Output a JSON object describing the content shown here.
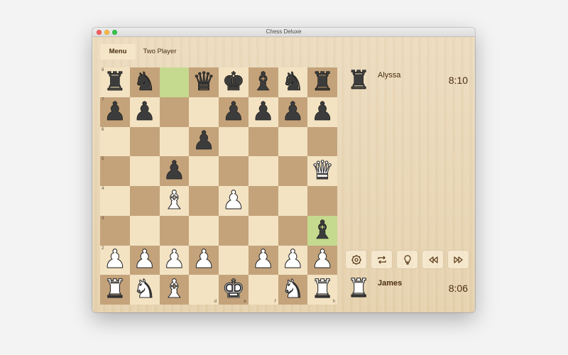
{
  "window": {
    "title": "Chess Deluxe"
  },
  "toolbar": {
    "menu_label": "Menu",
    "mode_label": "Two Player"
  },
  "board": {
    "rows": [
      [
        [
          "r",
          "b"
        ],
        [
          "n",
          "b"
        ],
        null,
        [
          "q",
          "b"
        ],
        [
          "k",
          "b"
        ],
        [
          "b",
          "b"
        ],
        [
          "n",
          "b"
        ],
        [
          "r",
          "b"
        ]
      ],
      [
        [
          "p",
          "b"
        ],
        [
          "p",
          "b"
        ],
        null,
        null,
        [
          "p",
          "b"
        ],
        [
          "p",
          "b"
        ],
        [
          "p",
          "b"
        ],
        [
          "p",
          "b"
        ]
      ],
      [
        null,
        null,
        null,
        [
          "p",
          "b"
        ],
        null,
        null,
        null,
        null
      ],
      [
        null,
        null,
        [
          "p",
          "b"
        ],
        null,
        null,
        null,
        null,
        [
          "q",
          "w"
        ]
      ],
      [
        null,
        null,
        [
          "b",
          "w"
        ],
        null,
        [
          "p",
          "w"
        ],
        null,
        null,
        null
      ],
      [
        null,
        null,
        null,
        null,
        null,
        null,
        null,
        [
          "b",
          "b"
        ]
      ],
      [
        [
          "p",
          "w"
        ],
        [
          "p",
          "w"
        ],
        [
          "p",
          "w"
        ],
        [
          "p",
          "w"
        ],
        null,
        [
          "p",
          "w"
        ],
        [
          "p",
          "w"
        ],
        [
          "p",
          "w"
        ]
      ],
      [
        [
          "r",
          "w"
        ],
        [
          "n",
          "w"
        ],
        [
          "b",
          "w"
        ],
        null,
        [
          "k",
          "w"
        ],
        null,
        [
          "n",
          "w"
        ],
        [
          "r",
          "w"
        ]
      ]
    ],
    "highlighted": [
      "c8",
      "h3"
    ],
    "rank_labels": [
      "8",
      "7",
      "6",
      "5",
      "4",
      "3",
      "2"
    ],
    "file_labels": [
      "d",
      "e",
      "f",
      "h"
    ],
    "colors": {
      "light": "#f3e3c3",
      "dark": "#c4a37b",
      "highlight": "#c5d98f"
    }
  },
  "players": {
    "top": {
      "name": "Alyssa",
      "clock": "8:10",
      "piece": "rook-black-icon"
    },
    "bottom": {
      "name": "James",
      "clock": "8:06",
      "piece": "rook-white-icon"
    }
  },
  "controls": [
    {
      "name": "settings-button",
      "icon": "gear-icon"
    },
    {
      "name": "flip-board-button",
      "icon": "rotate-arrows-icon"
    },
    {
      "name": "hint-button",
      "icon": "lightbulb-icon"
    },
    {
      "name": "rewind-button",
      "icon": "rewind-icon"
    },
    {
      "name": "fast-forward-button",
      "icon": "fast-forward-icon"
    }
  ]
}
